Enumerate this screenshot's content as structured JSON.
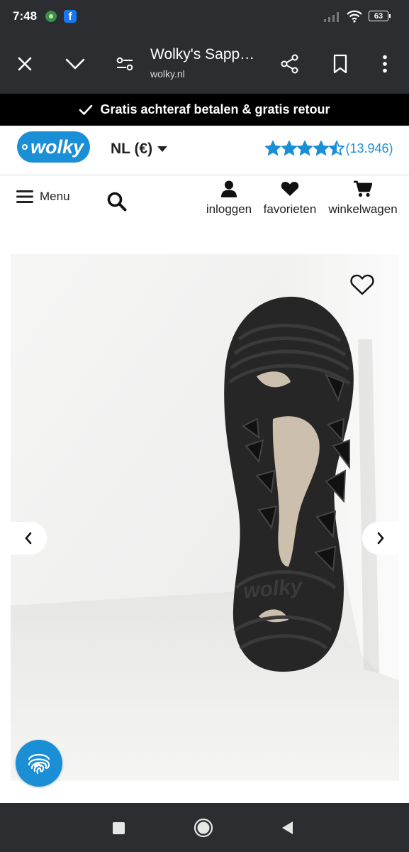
{
  "status_bar": {
    "time": "7:48",
    "battery": "63"
  },
  "browser": {
    "title": "Wolky's Sapp…",
    "url": "wolky.nl"
  },
  "promo": {
    "text": "Gratis achteraf betalen & gratis retour"
  },
  "header": {
    "logo_text": "wolky",
    "language": "NL (€)",
    "rating": {
      "stars": 4.5,
      "count": "(13.946)",
      "star_color": "#1b8fd6"
    }
  },
  "nav": {
    "menu_label": "Menu",
    "login_label": "inloggen",
    "favorites_label": "favorieten",
    "cart_label": "winkelwagen"
  },
  "product_image": {
    "logo_text": "wolky"
  },
  "colors": {
    "brand_blue": "#1b8fd6",
    "dark_chrome": "#2b2d30",
    "promo_bg": "#000000"
  }
}
